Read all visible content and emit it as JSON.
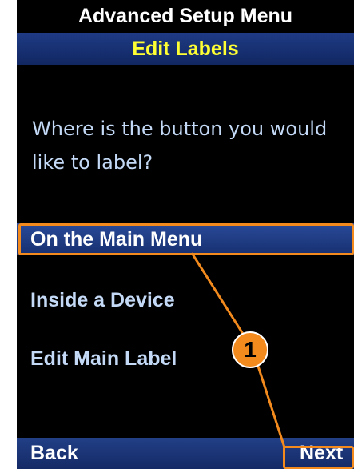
{
  "header": {
    "title": "Advanced Setup Menu",
    "subtitle": "Edit Labels"
  },
  "prompt": "Where is the button you would like to label?",
  "options": [
    {
      "label": "On the Main Menu",
      "selected": true
    },
    {
      "label": "Inside a Device",
      "selected": false
    },
    {
      "label": "Edit Main Label",
      "selected": false
    }
  ],
  "softkeys": {
    "back": "Back",
    "next": "Next"
  },
  "callout": {
    "number": "1",
    "color": "#f28a1e"
  },
  "colors": {
    "screen_bg": "#000000",
    "header_bar": "#1a3476",
    "header_title": "#ffffff",
    "subtitle_text": "#ffff33",
    "body_text": "#c3d9f6",
    "selection_bar": "#2a4a99",
    "highlight_outline": "#f28a1e"
  }
}
